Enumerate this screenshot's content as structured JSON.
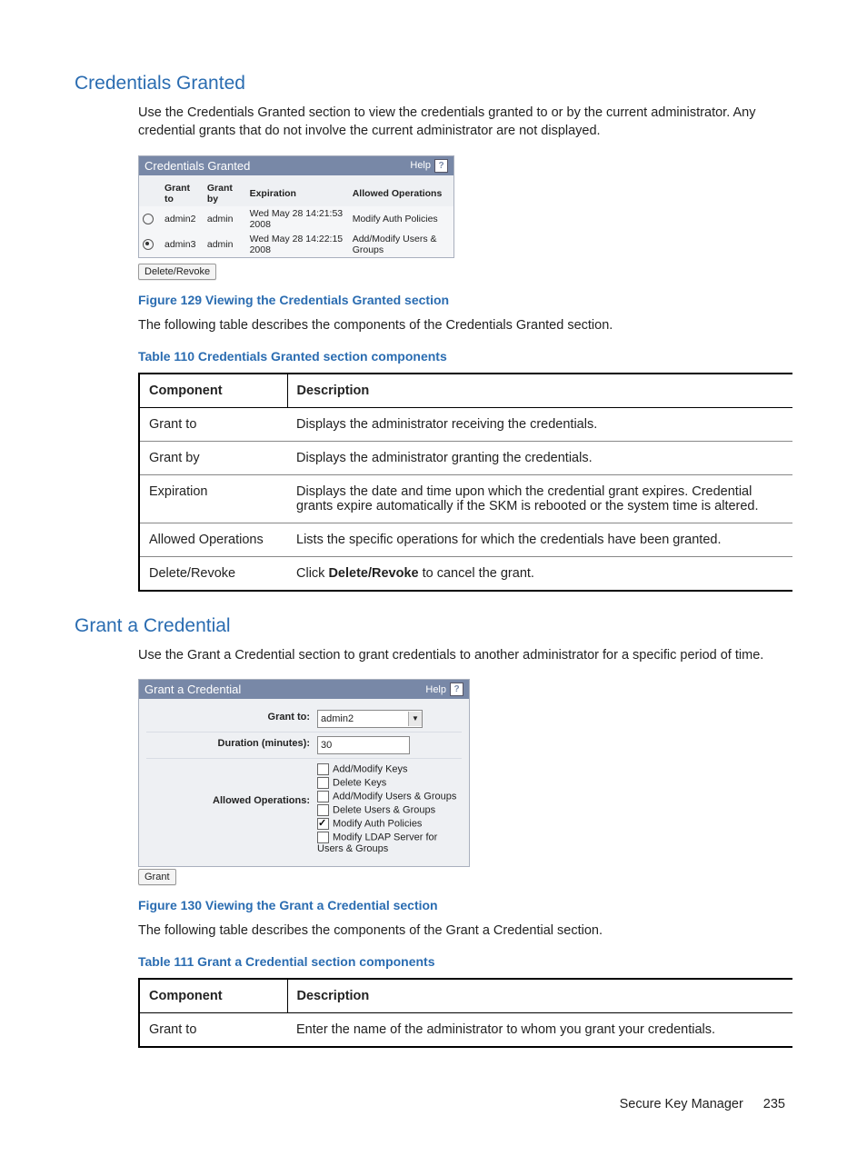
{
  "s1": {
    "title": "Credentials Granted",
    "p1": "Use the Credentials Granted section to view the credentials granted to or by the current administrator. Any credential grants that do not involve the current administrator are not displayed.",
    "panel": {
      "title": "Credentials Granted",
      "help": "Help",
      "headers": {
        "h1": "Grant to",
        "h2": "Grant by",
        "h3": "Expiration",
        "h4": "Allowed Operations"
      },
      "r1": {
        "to": "admin2",
        "by": "admin",
        "exp": "Wed May 28 14:21:53 2008",
        "ops": "Modify Auth Policies"
      },
      "r2": {
        "to": "admin3",
        "by": "admin",
        "exp": "Wed May 28 14:22:15 2008",
        "ops": "Add/Modify Users & Groups"
      },
      "button": "Delete/Revoke"
    },
    "fig": "Figure 129 Viewing the Credentials Granted section",
    "p2": "The following table describes the components of the Credentials Granted section.",
    "tabcap": "Table 110 Credentials Granted section components",
    "table": {
      "h1": "Component",
      "h2": "Description",
      "r1c1": "Grant to",
      "r1c2": "Displays the administrator receiving the credentials.",
      "r2c1": "Grant by",
      "r2c2": "Displays the administrator granting the credentials.",
      "r3c1": "Expiration",
      "r3c2": "Displays the date and time upon which the credential grant expires. Credential grants expire automatically if the SKM is rebooted or the system time is altered.",
      "r4c1": "Allowed Operations",
      "r4c2": "Lists the specific operations for which the credentials have been granted.",
      "r5c1": "Delete/Revoke",
      "r5c2a": "Click ",
      "r5c2b": "Delete/Revoke",
      "r5c2c": " to cancel the grant."
    }
  },
  "s2": {
    "title": "Grant a Credential",
    "p1": "Use the Grant a Credential section to grant credentials to another administrator for a specific period of time.",
    "panel": {
      "title": "Grant a Credential",
      "help": "Help",
      "l1": "Grant to:",
      "v1": "admin2",
      "l2": "Duration (minutes):",
      "v2": "30",
      "l3": "Allowed Operations:",
      "op1": "Add/Modify Keys",
      "op2": "Delete Keys",
      "op3": "Add/Modify Users & Groups",
      "op4": "Delete Users & Groups",
      "op5": "Modify Auth Policies",
      "op6": "Modify LDAP Server for Users & Groups",
      "button": "Grant"
    },
    "fig": "Figure 130 Viewing the Grant a Credential section",
    "p2": "The following table describes the components of the Grant a Credential section.",
    "tabcap": "Table 111 Grant a Credential section components",
    "table": {
      "h1": "Component",
      "h2": "Description",
      "r1c1": "Grant to",
      "r1c2": "Enter the name of the administrator to whom you grant your credentials."
    }
  },
  "chart_data": {
    "type": "table",
    "tables": [
      {
        "title": "Table 110 Credentials Granted section components",
        "columns": [
          "Component",
          "Description"
        ],
        "rows": [
          [
            "Grant to",
            "Displays the administrator receiving the credentials."
          ],
          [
            "Grant by",
            "Displays the administrator granting the credentials."
          ],
          [
            "Expiration",
            "Displays the date and time upon which the credential grant expires. Credential grants expire automatically if the SKM is rebooted or the system time is altered."
          ],
          [
            "Allowed Operations",
            "Lists the specific operations for which the credentials have been granted."
          ],
          [
            "Delete/Revoke",
            "Click Delete/Revoke to cancel the grant."
          ]
        ]
      },
      {
        "title": "Table 111 Grant a Credential section components",
        "columns": [
          "Component",
          "Description"
        ],
        "rows": [
          [
            "Grant to",
            "Enter the name of the administrator to whom you grant your credentials."
          ]
        ]
      }
    ]
  },
  "footer": {
    "product": "Secure Key Manager",
    "page": "235"
  }
}
